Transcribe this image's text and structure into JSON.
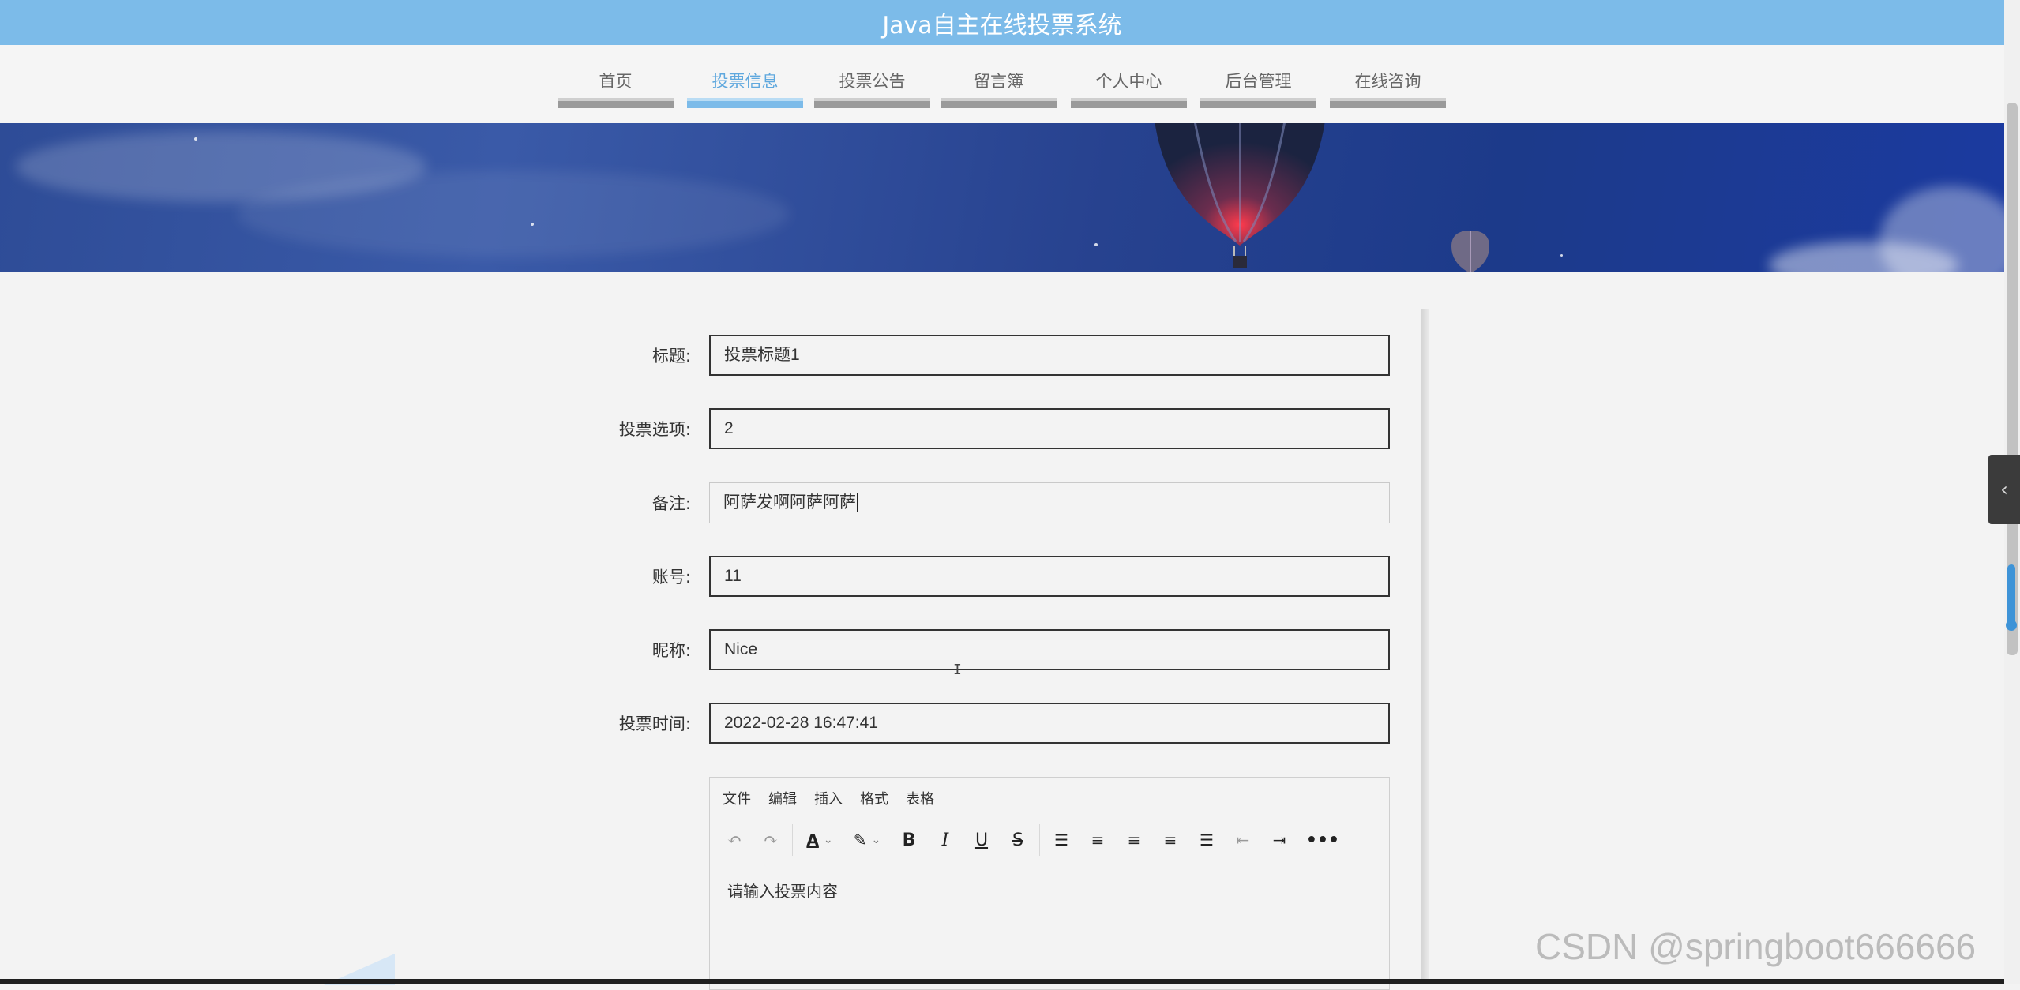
{
  "header": {
    "title": "Java自主在线投票系统"
  },
  "nav": {
    "items": [
      {
        "label": "首页",
        "active": false
      },
      {
        "label": "投票信息",
        "active": true
      },
      {
        "label": "投票公告",
        "active": false
      },
      {
        "label": "留言簿",
        "active": false
      },
      {
        "label": "个人中心",
        "active": false
      },
      {
        "label": "后台管理",
        "active": false
      },
      {
        "label": "在线咨询",
        "active": false
      }
    ]
  },
  "form": {
    "title": {
      "label": "标题:",
      "value": "投票标题1"
    },
    "option": {
      "label": "投票选项:",
      "value": "2"
    },
    "remark": {
      "label": "备注:",
      "value": "阿萨发啊阿萨阿萨"
    },
    "account": {
      "label": "账号:",
      "value": "11"
    },
    "nickname": {
      "label": "昵称:",
      "value": "Nice"
    },
    "vote_time": {
      "label": "投票时间:",
      "value": "2022-02-28 16:47:41"
    }
  },
  "editor": {
    "menu": [
      "文件",
      "编辑",
      "插入",
      "格式",
      "表格"
    ],
    "placeholder": "请输入投票内容"
  },
  "watermark": "CSDN @springboot666666",
  "colors": {
    "header_bg": "#7cbbe9",
    "nav_active": "#5fa8de",
    "side_tab": "#3b3b3b"
  }
}
